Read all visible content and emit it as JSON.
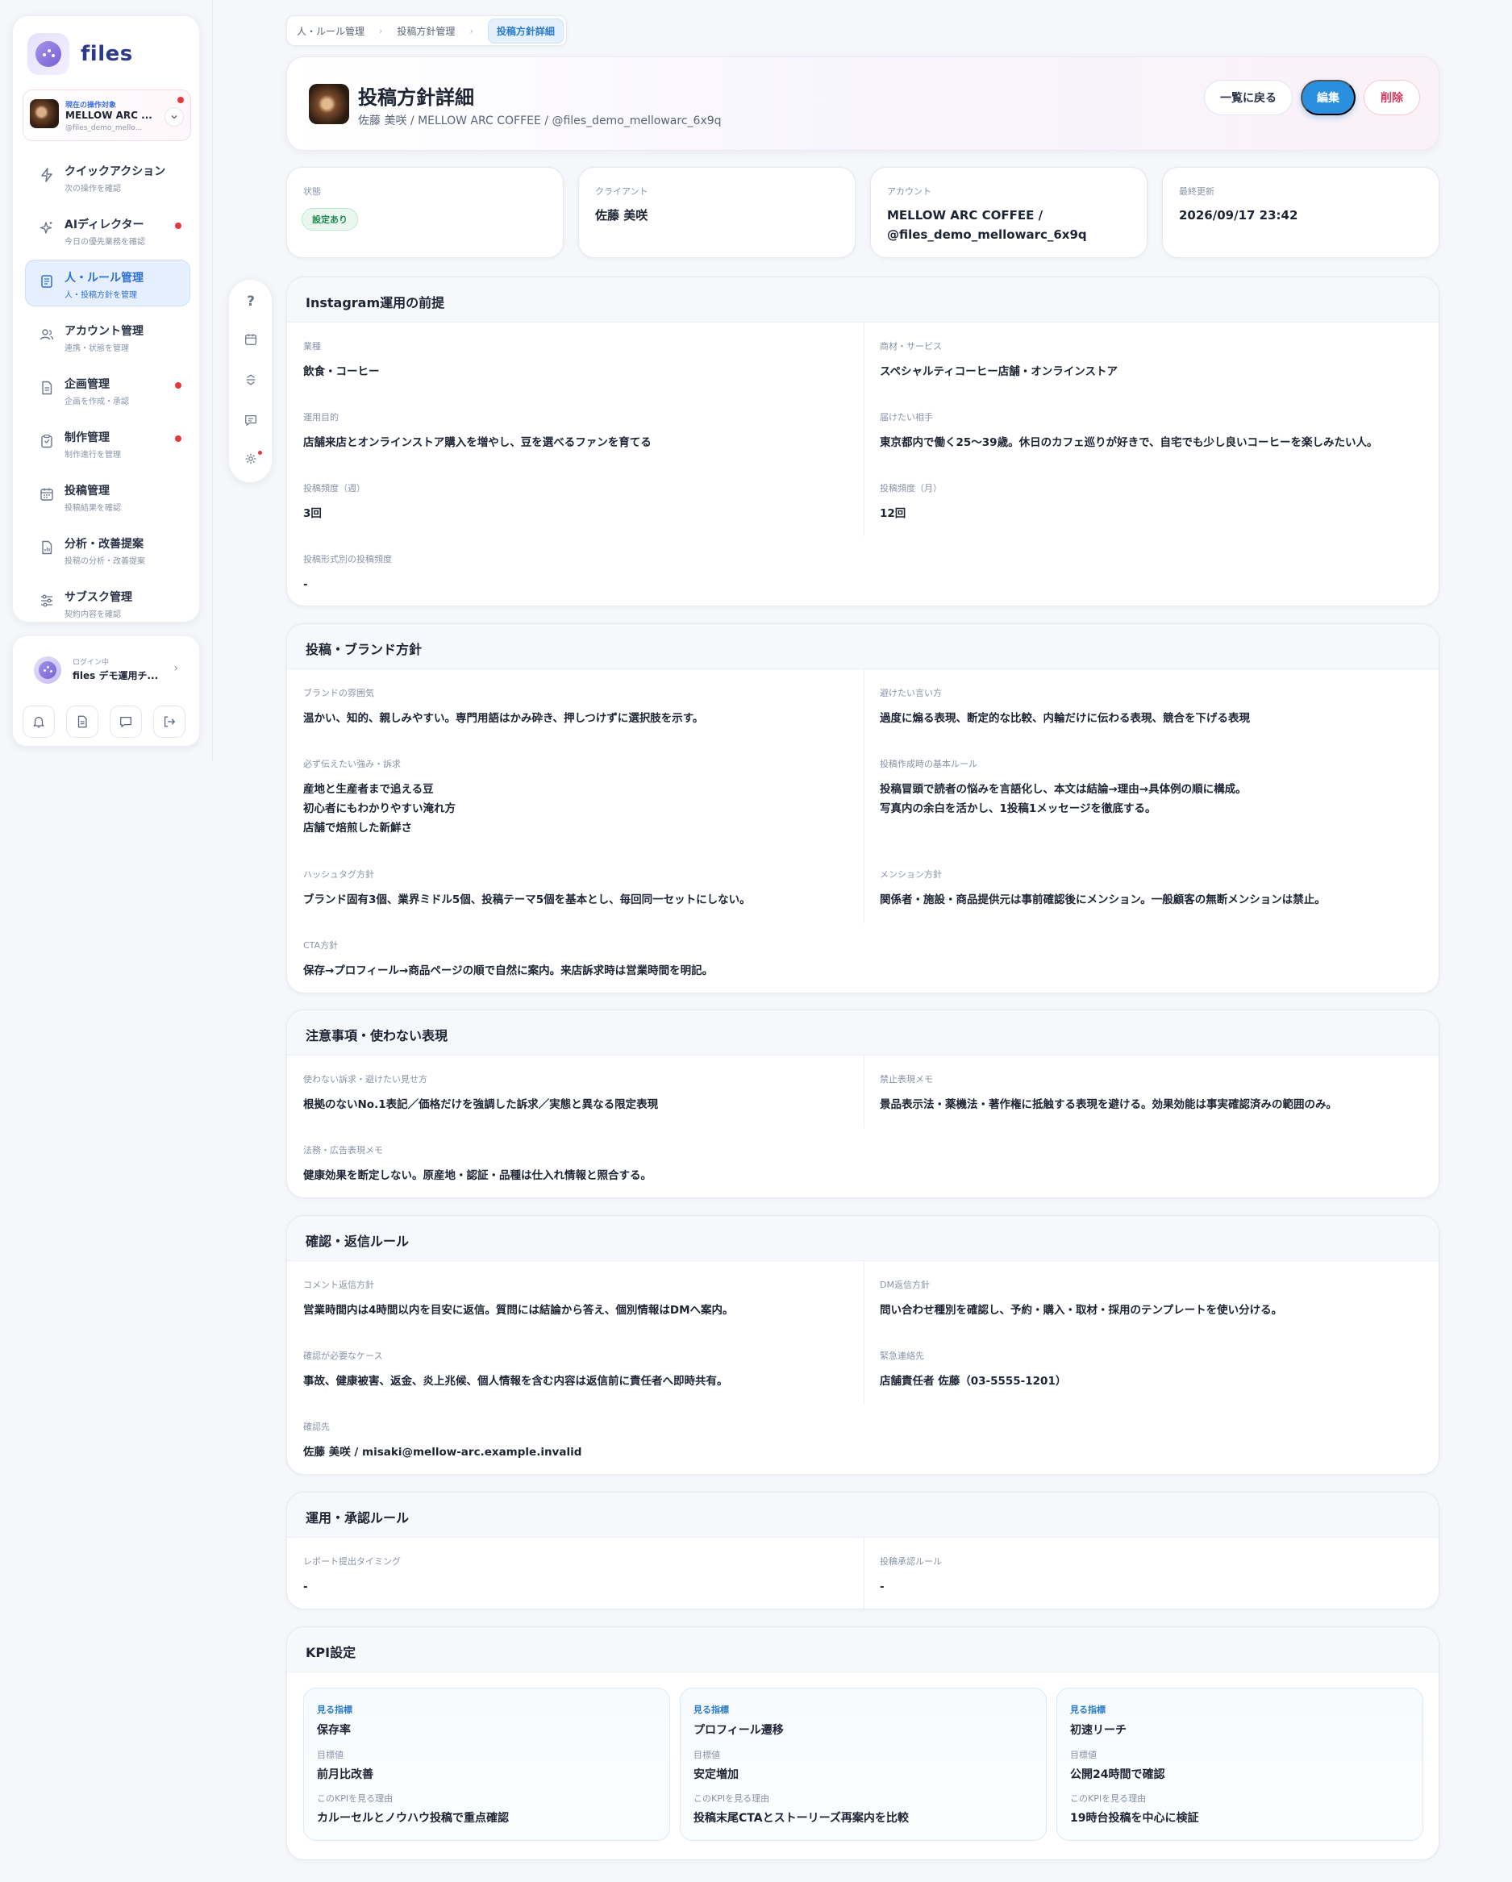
{
  "app": {
    "name": "files"
  },
  "account_selector": {
    "caption": "現在の操作対象",
    "name": "MELLOW ARC ...",
    "handle": "@files_demo_mello...",
    "expand_icon": "chevron-down-icon"
  },
  "nav": [
    {
      "label": "クイックアクション",
      "sub": "次の操作を確認",
      "icon": "lightning-icon",
      "alert": false,
      "active": false
    },
    {
      "label": "AIディレクター",
      "sub": "今日の優先業務を確認",
      "icon": "sparkle-icon",
      "alert": true,
      "active": false
    },
    {
      "label": "人・ルール管理",
      "sub": "人・投稿方針を管理",
      "icon": "book-icon",
      "alert": false,
      "active": true
    },
    {
      "label": "アカウント管理",
      "sub": "連携・状態を管理",
      "icon": "users-icon",
      "alert": false,
      "active": false
    },
    {
      "label": "企画管理",
      "sub": "企画を作成・承認",
      "icon": "document-icon",
      "alert": true,
      "active": false
    },
    {
      "label": "制作管理",
      "sub": "制作進行を管理",
      "icon": "clipboard-icon",
      "alert": true,
      "active": false
    },
    {
      "label": "投稿管理",
      "sub": "投稿結果を確認",
      "icon": "calendar-icon",
      "alert": false,
      "active": false
    },
    {
      "label": "分析・改善提案",
      "sub": "投稿の分析・改善提案",
      "icon": "report-icon",
      "alert": false,
      "active": false
    },
    {
      "label": "サブスク管理",
      "sub": "契約内容を確認",
      "icon": "sliders-icon",
      "alert": false,
      "active": false
    }
  ],
  "user": {
    "caption": "ログイン中",
    "name": "files デモ運用チ...",
    "buttons": [
      "bell-icon",
      "document-icon",
      "chat-icon",
      "logout-icon"
    ]
  },
  "rail": [
    "help-icon",
    "calendar-icon",
    "collapse-icon",
    "comment-icon",
    "settings-alert-icon"
  ],
  "breadcrumb": [
    "人・ルール管理",
    "投稿方針管理",
    "投稿方針詳細"
  ],
  "header": {
    "title": "投稿方針詳細",
    "subtitle": "佐藤 美咲 / MELLOW ARC COFFEE / @files_demo_mellowarc_6x9q",
    "back_label": "一覧に戻る",
    "edit_label": "編集",
    "delete_label": "削除"
  },
  "stats": {
    "status": {
      "label": "状態",
      "value": "設定あり"
    },
    "client": {
      "label": "クライアント",
      "value": "佐藤 美咲"
    },
    "account": {
      "label": "アカウント",
      "value_line1": "MELLOW ARC COFFEE /",
      "value_line2": "@files_demo_mellowarc_6x9q"
    },
    "updated": {
      "label": "最終更新",
      "value": "2026/09/17 23:42"
    }
  },
  "sections": {
    "premise": {
      "title": "Instagram運用の前提",
      "industry": {
        "label": "業種",
        "value": "飲食・コーヒー"
      },
      "product": {
        "label": "商材・サービス",
        "value": "スペシャルティコーヒー店舗・オンラインストア"
      },
      "purpose": {
        "label": "運用目的",
        "value": "店舗来店とオンラインストア購入を増やし、豆を選べるファンを育てる"
      },
      "target": {
        "label": "届けたい相手",
        "value": "東京都内で働く25〜39歳。休日のカフェ巡りが好きで、自宅でも少し良いコーヒーを楽しみたい人。"
      },
      "freq_week": {
        "label": "投稿頻度（週）",
        "value": "3回"
      },
      "freq_month": {
        "label": "投稿頻度（月）",
        "value": "12回"
      },
      "freq_format": {
        "label": "投稿形式別の投稿頻度",
        "value": "-"
      }
    },
    "brand": {
      "title": "投稿・ブランド方針",
      "tone": {
        "label": "ブランドの雰囲気",
        "value": "温かい、知的、親しみやすい。専門用語はかみ砕き、押しつけずに選択肢を示す。"
      },
      "avoid": {
        "label": "避けたい言い方",
        "value": "過度に煽る表現、断定的な比較、内輪だけに伝わる表現、競合を下げる表現"
      },
      "strengths": {
        "label": "必ず伝えたい強み・訴求",
        "line1": "産地と生産者まで追える豆",
        "line2": "初心者にもわかりやすい淹れ方",
        "line3": "店舗で焙煎した新鮮さ"
      },
      "rules": {
        "label": "投稿作成時の基本ルール",
        "line1": "投稿冒頭で読者の悩みを言語化し、本文は結論→理由→具体例の順に構成。",
        "line2": "写真内の余白を活かし、1投稿1メッセージを徹底する。"
      },
      "hashtag": {
        "label": "ハッシュタグ方針",
        "value": "ブランド固有3個、業界ミドル5個、投稿テーマ5個を基本とし、毎回同一セットにしない。"
      },
      "mention": {
        "label": "メンション方針",
        "value": "関係者・施設・商品提供元は事前確認後にメンション。一般顧客の無断メンションは禁止。"
      },
      "cta": {
        "label": "CTA方針",
        "value": "保存→プロフィール→商品ページの順で自然に案内。来店訴求時は営業時間を明記。"
      }
    },
    "caution": {
      "title": "注意事項・使わない表現",
      "unused": {
        "label": "使わない訴求・避けたい見せ方",
        "value": "根拠のないNo.1表記／価格だけを強調した訴求／実態と異なる限定表現"
      },
      "banned": {
        "label": "禁止表現メモ",
        "value": "景品表示法・薬機法・著作権に抵触する表現を避ける。効果効能は事実確認済みの範囲のみ。"
      },
      "legal": {
        "label": "法務・広告表現メモ",
        "value": "健康効果を断定しない。原産地・認証・品種は仕入れ情報と照合する。"
      }
    },
    "reply": {
      "title": "確認・返信ルール",
      "comment": {
        "label": "コメント返信方針",
        "value": "営業時間内は4時間以内を目安に返信。質問には結論から答え、個別情報はDMへ案内。"
      },
      "dm": {
        "label": "DM返信方針",
        "value": "問い合わせ種別を確認し、予約・購入・取材・採用のテンプレートを使い分ける。"
      },
      "cases": {
        "label": "確認が必要なケース",
        "value": "事故、健康被害、返金、炎上兆候、個人情報を含む内容は返信前に責任者へ即時共有。"
      },
      "emergency": {
        "label": "緊急連絡先",
        "value": "店舗責任者 佐藤（03-5555-1201）"
      },
      "contact": {
        "label": "確認先",
        "value": "佐藤 美咲 / misaki@mellow-arc.example.invalid"
      }
    },
    "ops": {
      "title": "運用・承認ルール",
      "report": {
        "label": "レポート提出タイミング",
        "value": "-"
      },
      "approval": {
        "label": "投稿承認ルール",
        "value": "-"
      }
    },
    "kpi": {
      "title": "KPI設定",
      "metric_label": "見る指標",
      "target_label": "目標値",
      "reason_label": "このKPIを見る理由",
      "items": [
        {
          "metric": "保存率",
          "target": "前月比改善",
          "reason": "カルーセルとノウハウ投稿で重点確認"
        },
        {
          "metric": "プロフィール遷移",
          "target": "安定増加",
          "reason": "投稿末尾CTAとストーリーズ再案内を比較"
        },
        {
          "metric": "初速リーチ",
          "target": "公開24時間で確認",
          "reason": "19時台投稿を中心に検証"
        }
      ]
    }
  },
  "colors": {
    "accent": "#2b8fe0",
    "active_nav": "#2f6fd8",
    "alert": "#e5383b",
    "status_green": "#1c8a4d",
    "delete": "#d43a5b"
  }
}
